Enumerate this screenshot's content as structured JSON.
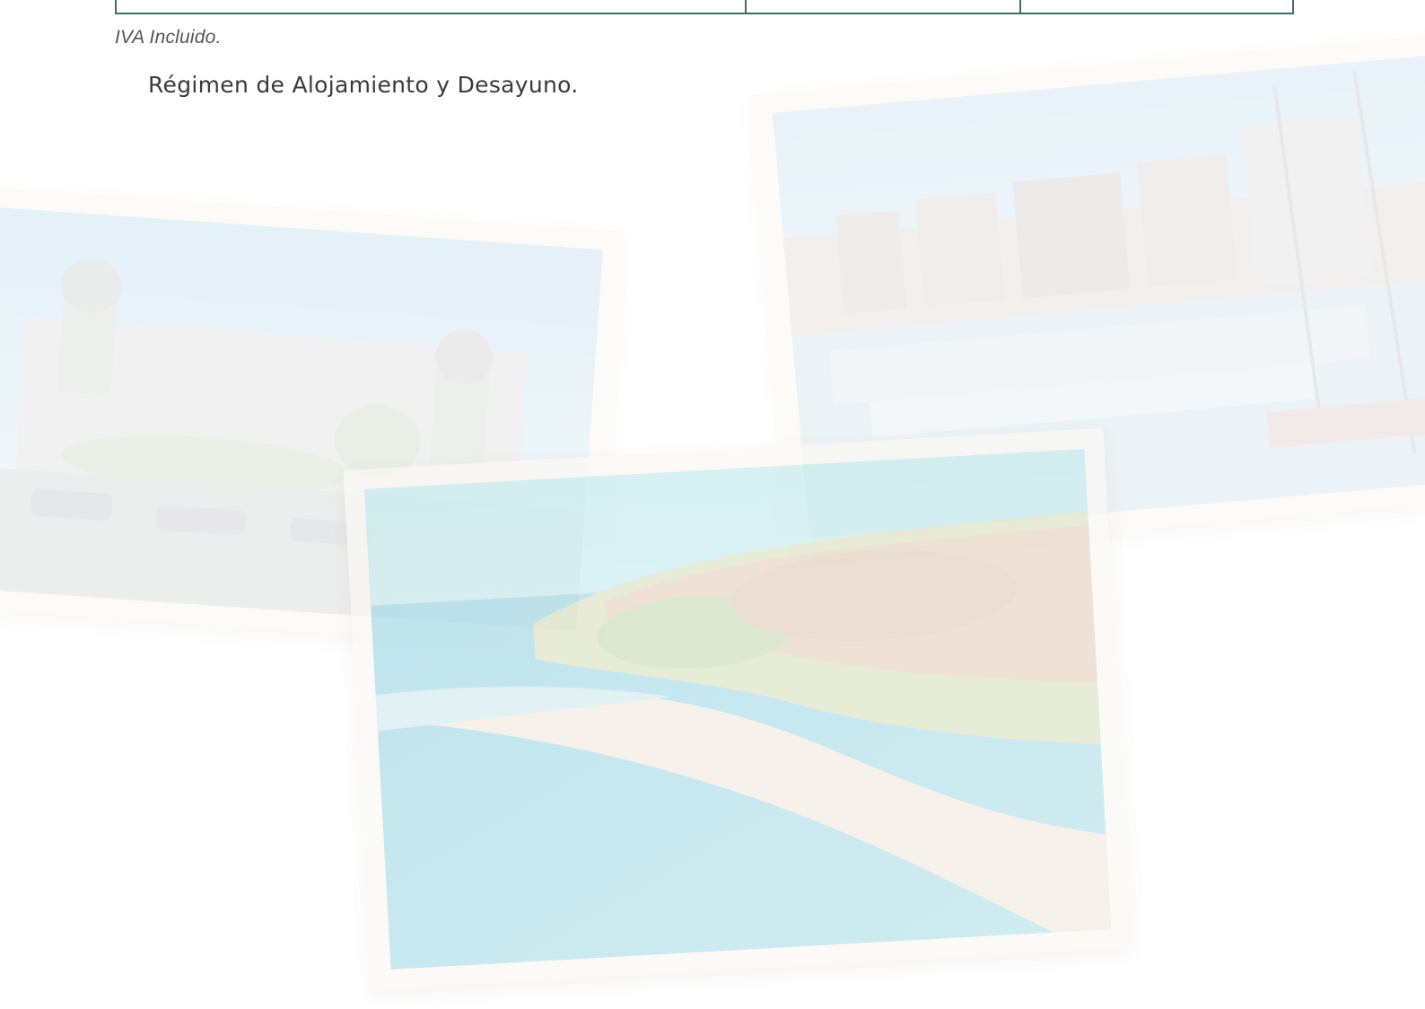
{
  "table": {
    "border_color": "#3f6e64"
  },
  "notes": {
    "vat": "IVA Incluido.",
    "regime": "Régimen de Alojamiento y Desayuno."
  },
  "decor": {
    "photos": [
      {
        "name": "cathedral-photo"
      },
      {
        "name": "marina-photo"
      },
      {
        "name": "beach-photo"
      }
    ]
  }
}
